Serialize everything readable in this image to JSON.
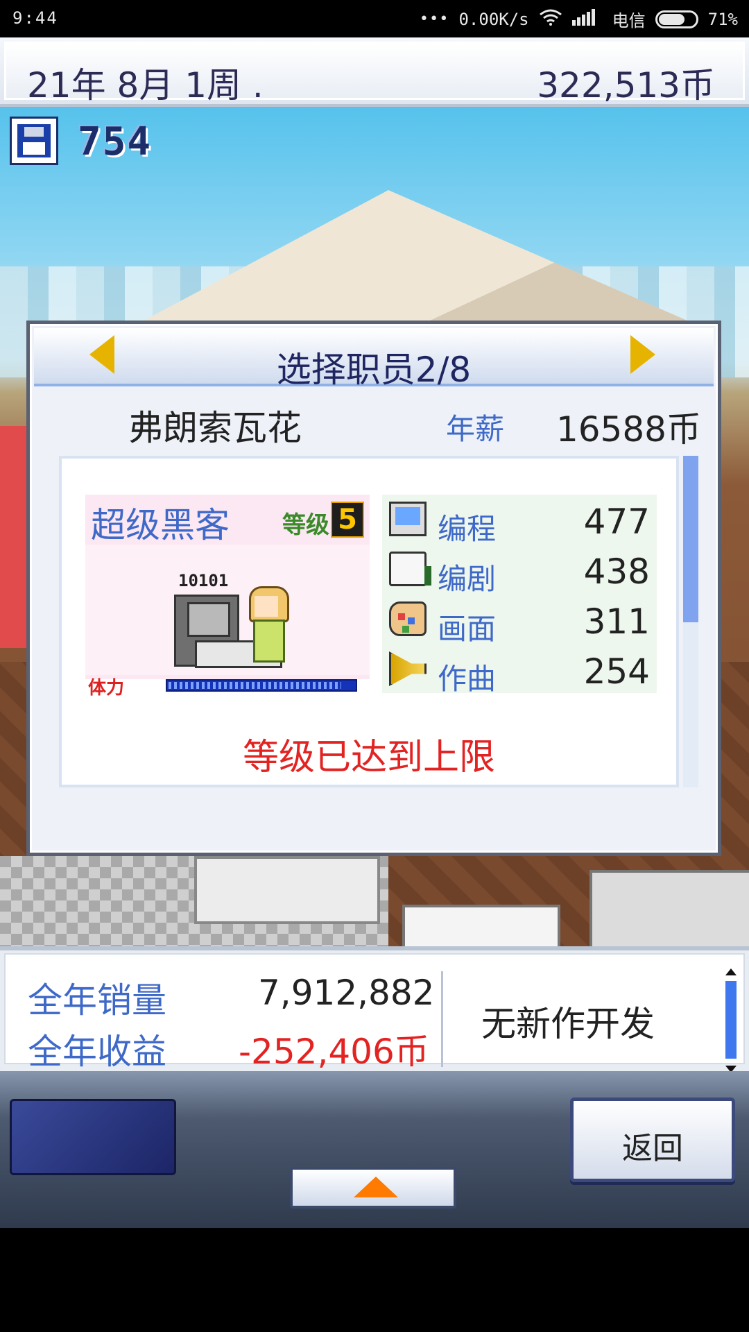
{
  "status_bar": {
    "time": "9:44",
    "network_speed": "0.00K/s",
    "carrier": "电信",
    "battery_percent": "71%",
    "battery_level": 0.71
  },
  "top_bar": {
    "date": "21年 8月 1周 .",
    "money": "322,513币"
  },
  "save": {
    "count": "754",
    "icon": "floppy-disk-icon"
  },
  "dialog": {
    "title": "选择职员2/8",
    "prev_icon": "arrow-left-icon",
    "next_icon": "arrow-right-icon",
    "employee_name": "弗朗索瓦花",
    "salary_label": "年薪",
    "salary_value": "16588币",
    "job_title": "超级黑客",
    "level_label": "等级",
    "level_value": "5",
    "art_text": "10101",
    "stamina_label": "体力",
    "stamina_level": 0.93,
    "stats": [
      {
        "label": "编程",
        "value": "477",
        "icon": "monitor-icon"
      },
      {
        "label": "编剧",
        "value": "438",
        "icon": "book-icon"
      },
      {
        "label": "画面",
        "value": "311",
        "icon": "palette-icon"
      },
      {
        "label": "作曲",
        "value": "254",
        "icon": "trumpet-icon"
      }
    ],
    "message": "等级已达到上限"
  },
  "info_bar": {
    "sales_label": "全年销量",
    "sales_value": "7,912,882",
    "profit_label": "全年收益",
    "profit_value": "-252,406币",
    "dev_status": "无新作开发"
  },
  "controls": {
    "back_label": "返回"
  },
  "colors": {
    "accent_blue": "#3f69c8",
    "negative_red": "#e32222",
    "title_navy": "#1e2560",
    "arrow_yellow": "#e6b400"
  }
}
